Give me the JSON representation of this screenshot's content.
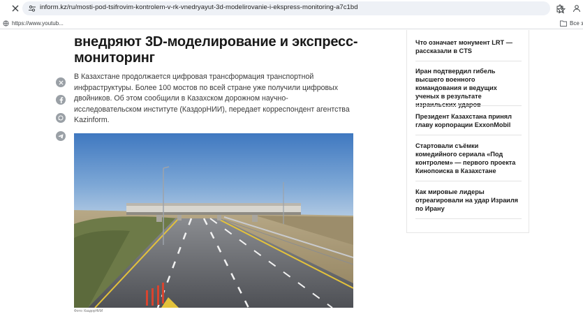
{
  "browser": {
    "url": "inform.kz/ru/mosti-pod-tsifrovim-kontrolem-v-rk-vnedryayut-3d-modelirovanie-i-ekspress-monitoring-a7c1bd",
    "bookmark": "https://www.youtub...",
    "all_bookmarks": "Все за"
  },
  "article": {
    "title": "внедряют 3D-моделирование и экспресс-мониторинг",
    "lead": "В Казахстане продолжается цифровая трансформация транспортной инфраструктуры. Более 100 мостов по всей стране уже получили цифровых двойников. Об этом сообщили в Казахском дорожном научно-исследовательском институте (КаздорНИИ), передает корреспондент агентства Kazinform.",
    "photo_caption": "Фото: КаздорНИИ",
    "share_icons": [
      "x-icon",
      "facebook-icon",
      "whatsapp-icon",
      "telegram-icon"
    ]
  },
  "sidebar": {
    "items": [
      "Что означает монумент LRT — рассказали в CTS",
      "Иран подтвердил гибель высшего военного командования и ведущих ученых в результате израильских ударов",
      "Президент Казахстана принял главу корпорации ExxonMobil",
      "Стартовали съёмки комедийного сериала «Под контролем» — первого проекта Кинопоиска в Казахстане",
      "Как мировые лидеры отреагировали на удар Израиля по Ирану"
    ]
  },
  "colors": {
    "icon_gray": "#9aa0a6",
    "omnibox_bg": "#eef1f6",
    "sky_top": "#3f78c0",
    "road": "#5f6166"
  }
}
